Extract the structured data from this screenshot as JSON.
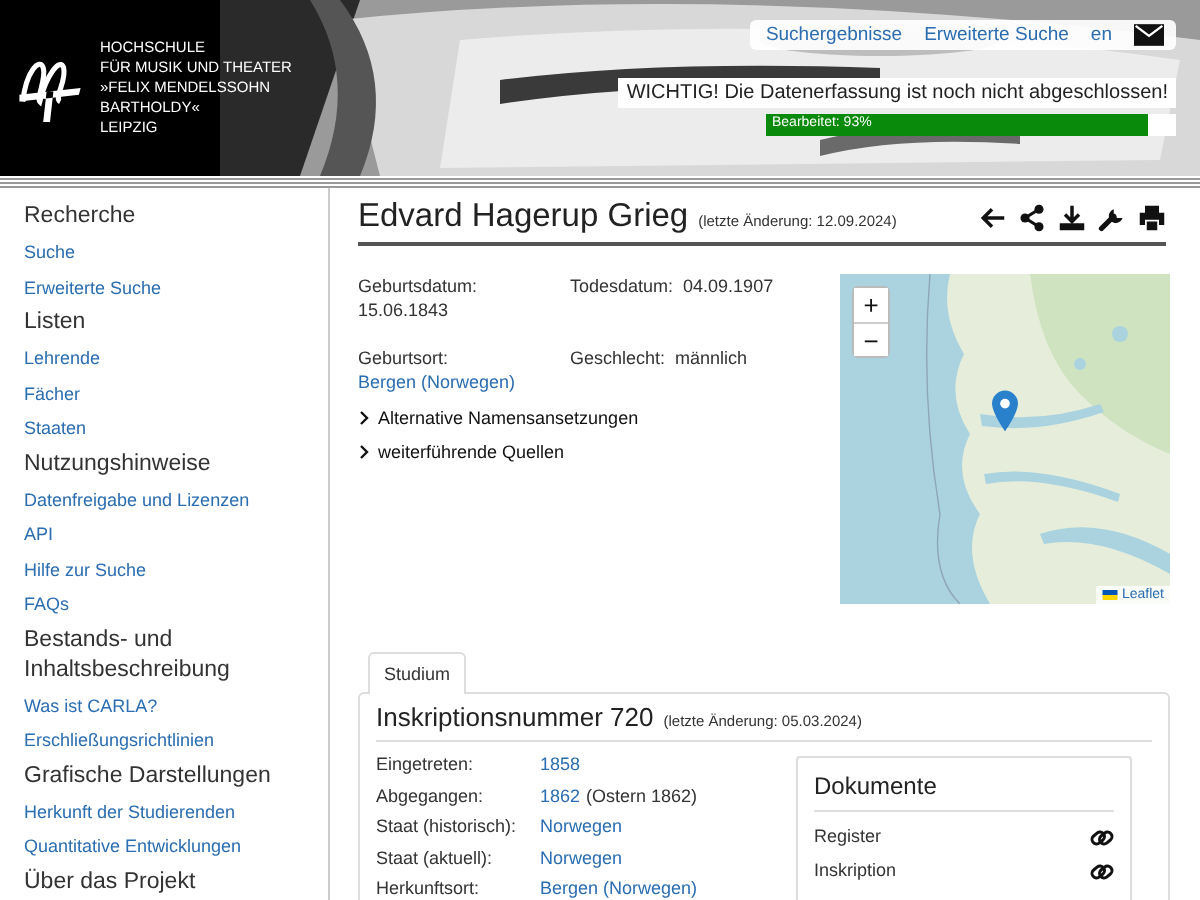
{
  "header": {
    "institution_lines": [
      "HOCHSCHULE",
      "FÜR MUSIK UND THEATER",
      "»FELIX MENDELSSOHN",
      "BARTHOLDY«",
      "LEIPZIG"
    ],
    "nav_links": [
      {
        "label": "Suchergebnisse"
      },
      {
        "label": "Erweiterte Suche"
      },
      {
        "label": "en"
      }
    ],
    "notice": "WICHTIG! Die Datenerfassung ist noch nicht abgeschlossen!",
    "progress": {
      "label": "Bearbeitet: 93%",
      "level": 0.93
    }
  },
  "sidebar": {
    "sections": [
      {
        "heading": "Recherche",
        "items": [
          "Suche",
          "Erweiterte Suche"
        ]
      },
      {
        "heading": "Listen",
        "items": [
          "Lehrende",
          "Fächer",
          "Staaten"
        ]
      },
      {
        "heading": "Nutzungshinweise",
        "items": [
          "Datenfreigabe und Lizenzen",
          "API",
          "Hilfe zur Suche",
          "FAQs"
        ]
      },
      {
        "heading": "Bestands- und Inhaltsbeschreibung",
        "items": [
          "Was ist CARLA?",
          "Erschließungsrichtlinien"
        ]
      },
      {
        "heading": "Grafische Darstellungen",
        "items": [
          "Herkunft der Studierenden",
          "Quantitative Entwicklungen"
        ]
      },
      {
        "heading": "Über das Projekt"
      }
    ]
  },
  "person": {
    "name": "Edvard Hagerup Grieg",
    "last_change": "(letzte Änderung: 12.09.2024)",
    "facts": [
      {
        "label": "Geburtsdatum:",
        "value": "15.06.1843",
        "kind": "text"
      },
      {
        "label": "Todesdatum:",
        "value": "04.09.1907",
        "kind": "text"
      },
      {
        "label": "Geburtsort:",
        "value": "Bergen (Norwegen)",
        "kind": "link"
      },
      {
        "label": "Geschlecht:",
        "value": "männlich",
        "kind": "text"
      }
    ],
    "expanders": [
      {
        "label": "Alternative Namensansetzungen",
        "expanded": false
      },
      {
        "label": "weiterführende Quellen",
        "expanded": false
      }
    ],
    "map": {
      "zoom_in": "+",
      "zoom_out": "−",
      "attribution": "Leaflet"
    }
  },
  "tabs": [
    {
      "label": "Studium",
      "selected": true
    }
  ],
  "inscription": {
    "title": "Inskriptionsnummer 720",
    "last_change": "(letzte Änderung: 05.03.2024)",
    "rows": [
      {
        "label": "Eingetreten:",
        "link": "1858"
      },
      {
        "label": "Abgegangen:",
        "link": "1862",
        "note": "(Ostern 1862)"
      },
      {
        "label": "Staat (historisch):",
        "link": "Norwegen"
      },
      {
        "label": "Staat (aktuell):",
        "link": "Norwegen"
      },
      {
        "label": "Herkunftsort:",
        "link": "Bergen (Norwegen)"
      }
    ],
    "documents": {
      "title": "Dokumente",
      "items": [
        "Register",
        "Inskription"
      ]
    }
  }
}
